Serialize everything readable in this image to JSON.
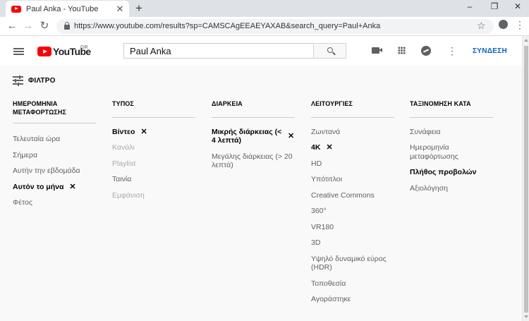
{
  "browser": {
    "tab_title": "Paul Anka - YouTube",
    "tab_close": "✕",
    "new_tab": "+",
    "url": "https://www.youtube.com/results?sp=CAMSCAgEEAEYAXAB&search_query=Paul+Anka",
    "back": "←",
    "forward": "→",
    "reload": "↻",
    "star": "☆",
    "menu": "⋮",
    "win_minimize": "–",
    "win_maximize": "❐",
    "win_close": "✕"
  },
  "youtube": {
    "logo_text": "YouTube",
    "country_code": "GR",
    "search_value": "Paul Anka",
    "more": "⋮",
    "signin_label": "ΣΥΝΔΕΣΗ"
  },
  "filters": {
    "toggle_label": "ΦΙΛΤΡΟ",
    "clear_mark": "✕",
    "columns": [
      {
        "header": "ΗΜΕΡΟΜΗΝΙΑ ΜΕΤΑΦΟΡΤΩΣΗΣ",
        "options": [
          {
            "label": "Τελευταία ώρα"
          },
          {
            "label": "Σήμερα"
          },
          {
            "label": "Αυτήν την εβδομάδα"
          },
          {
            "label": "Αυτόν το μήνα"
          },
          {
            "label": "Φέτος"
          }
        ]
      },
      {
        "header": "ΤΥΠΟΣ",
        "options": [
          {
            "label": "Βίντεο"
          },
          {
            "label": "Κανάλι"
          },
          {
            "label": "Playlist"
          },
          {
            "label": "Ταινία"
          },
          {
            "label": "Εμφάνιση"
          }
        ]
      },
      {
        "header": "ΔΙΑΡΚΕΙΑ",
        "options": [
          {
            "label": "Μικρής διάρκειας (< 4 λεπτά)"
          },
          {
            "label": "Μεγάλης διάρκειας (> 20 λεπτά)"
          }
        ]
      },
      {
        "header": "ΛΕΙΤΟΥΡΓΙΕΣ",
        "options": [
          {
            "label": "Ζωντανά"
          },
          {
            "label": "4K"
          },
          {
            "label": "HD"
          },
          {
            "label": "Υπότιτλοι"
          },
          {
            "label": "Creative Commons"
          },
          {
            "label": "360°"
          },
          {
            "label": "VR180"
          },
          {
            "label": "3D"
          },
          {
            "label": "Υψηλό δυναμικό εύρος (HDR)"
          },
          {
            "label": "Τοποθεσία"
          },
          {
            "label": "Αγοράστηκε"
          }
        ]
      },
      {
        "header": "ΤΑΞΙΝΟΜΗΣΗ ΚΑΤΑ",
        "options": [
          {
            "label": "Συνάφεια"
          },
          {
            "label": "Ημερομηνία μεταφόρτωσης"
          },
          {
            "label": "Πλήθος προβολών"
          },
          {
            "label": "Αξιολόγηση"
          }
        ]
      }
    ]
  }
}
